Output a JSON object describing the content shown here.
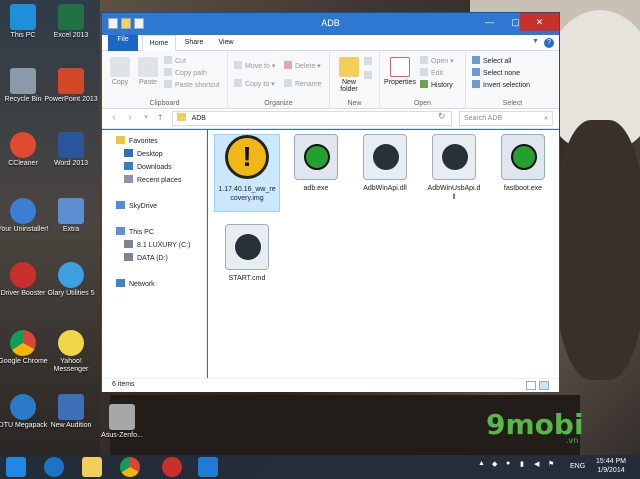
{
  "desktop": {
    "icons": [
      {
        "label": "This PC"
      },
      {
        "label": "Excel 2013"
      },
      {
        "label": "Recycle Bin"
      },
      {
        "label": "PowerPoint 2013"
      },
      {
        "label": "CCleaner"
      },
      {
        "label": "Word 2013"
      },
      {
        "label": "Your Uninstaller!"
      },
      {
        "label": "Extra"
      },
      {
        "label": "Driver Booster"
      },
      {
        "label": "Glary Utilities 5"
      },
      {
        "label": "Google Chrome"
      },
      {
        "label": "Yahoo! Messenger"
      },
      {
        "label": "DTU Megapack"
      },
      {
        "label": "New Audition"
      },
      {
        "label": "Asus-Zenfo..."
      }
    ]
  },
  "window": {
    "title": "ADB",
    "min_glyph": "—",
    "max_glyph": "▢",
    "close_glyph": "✕"
  },
  "ribbon": {
    "tabs": {
      "file": "File",
      "home": "Home",
      "share": "Share",
      "view": "View"
    },
    "help_glyph": "?",
    "clipboard": {
      "copy": "Copy",
      "paste": "Paste",
      "cut": "Cut",
      "copy_path": "Copy path",
      "paste_shortcut": "Paste shortcut",
      "label": "Clipboard"
    },
    "organize": {
      "move_to": "Move to",
      "copy_to": "Copy to",
      "delete": "Delete",
      "rename": "Rename",
      "label": "Organize"
    },
    "new": {
      "new_folder": "New folder",
      "label": "New"
    },
    "open": {
      "properties": "Properties",
      "open": "Open",
      "edit": "Edit",
      "history": "History",
      "label": "Open"
    },
    "select": {
      "select_all": "Select all",
      "select_none": "Select none",
      "invert": "Invert selection",
      "label": "Select"
    }
  },
  "address": {
    "path": "ADB",
    "search_placeholder": "Search ADB"
  },
  "nav": {
    "favorites": "Favorites",
    "desktop": "Desktop",
    "downloads": "Downloads",
    "recent": "Recent places",
    "skydrive": "SkyDrive",
    "this_pc": "This PC",
    "drive_c": "8.1 LUXURY (C:)",
    "drive_d": "DATA (D:)",
    "network": "Network"
  },
  "files": [
    {
      "name": "1.17.40.16_ww_recovery.img",
      "line1": "1.17.40.16_ww_re",
      "line2": "covery.img",
      "icon": "warning-icon"
    },
    {
      "name": "adb.exe",
      "icon": "android-exe-icon"
    },
    {
      "name": "AdbWinApi.dll",
      "icon": "dll-gear-icon"
    },
    {
      "name": "AdbWinUsbApi.dll",
      "line1": "AdbWinUsbApi.d",
      "line2": "ll",
      "icon": "dll-gear-icon"
    },
    {
      "name": "fastboot.exe",
      "icon": "android-exe-icon"
    },
    {
      "name": "START.cmd",
      "icon": "cmd-gear-icon"
    }
  ],
  "status": {
    "count": "6 items"
  },
  "taskbar": {
    "lang": "ENG",
    "time": "15:44 PM",
    "date": "1/9/2014"
  },
  "watermark": {
    "text": "9mobi",
    "sub": ".vn"
  }
}
